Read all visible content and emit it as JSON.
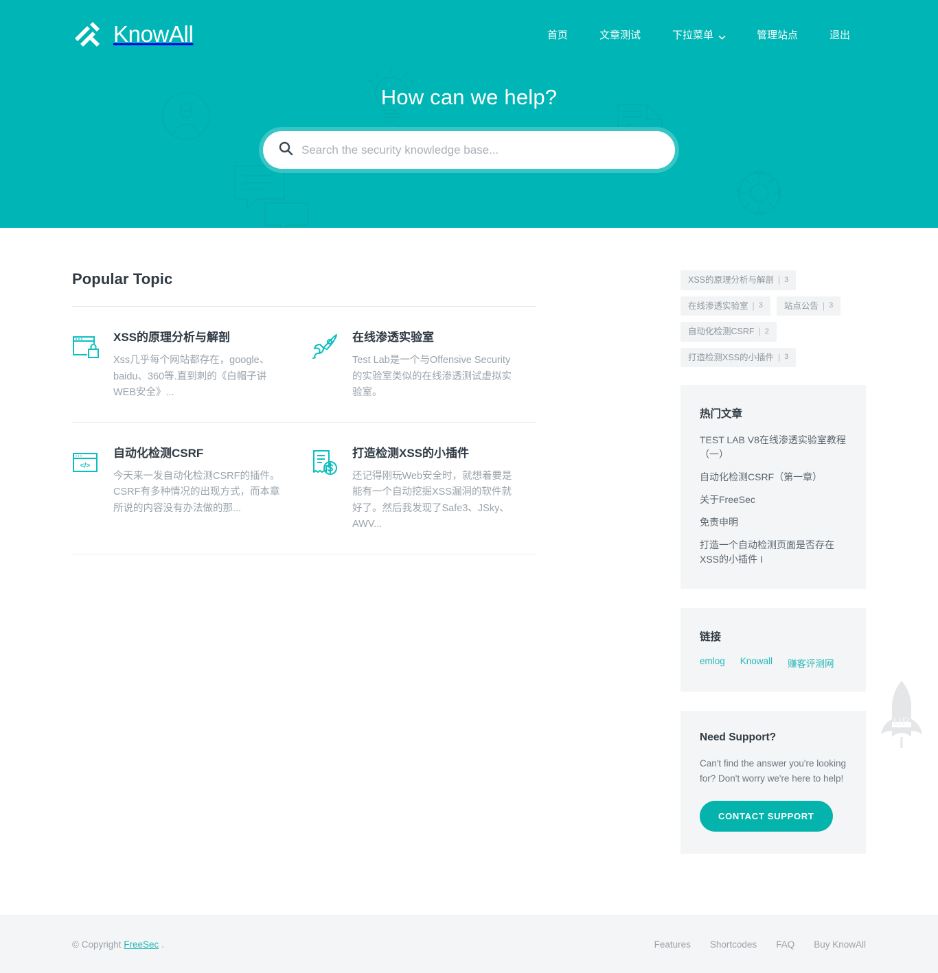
{
  "theme": {
    "brand_teal": "#00b5b5",
    "accent_teal": "#04b3ac",
    "link_teal": "#26b8b8",
    "panel_grey": "#f4f5f6",
    "text_dark": "#2f3a44",
    "text_muted": "#9aa3aa"
  },
  "header": {
    "brand_name": "KnowAll",
    "logo_icon": "knowall-hatch-logo-icon",
    "nav": [
      {
        "label": "首页",
        "icon": null
      },
      {
        "label": "文章测试",
        "icon": null
      },
      {
        "label": "下拉菜单",
        "icon": "chevron-down-icon"
      },
      {
        "label": "管理站点",
        "icon": null
      },
      {
        "label": "退出",
        "icon": null
      }
    ]
  },
  "hero": {
    "title": "How can we help?",
    "search": {
      "icon": "search-icon",
      "value": "",
      "placeholder": "Search the security knowledge base..."
    },
    "decorations": [
      "user-avatar-outline-icon",
      "lightbulb-outline-icon",
      "document-checklist-outline-icon",
      "chat-bubbles-outline-icon",
      "life-ring-outline-icon"
    ]
  },
  "main": {
    "section_title": "Popular Topic",
    "topics": [
      {
        "icon": "browser-lock-icon",
        "title": "XSS的原理分析与解剖",
        "desc": "Xss几乎每个网站都存在，google、baidu、360等.直到刺的《白帽子讲WEB安全》..."
      },
      {
        "icon": "rocket-icon",
        "title": "在线渗透实验室",
        "desc": "Test Lab是一个与Offensive Security的实验室类似的在线渗透测试虚拟实验室。"
      },
      {
        "icon": "code-window-icon",
        "title": "自动化检测CSRF",
        "desc": "今天来一发自动化检测CSRF的插件。CSRF有多种情况的出现方式，而本章所说的内容没有办法做的那..."
      },
      {
        "icon": "invoice-dollar-icon",
        "title": "打造检测XSS的小插件",
        "desc": "还记得刚玩Web安全时，就想着要是能有一个自动挖掘XSS漏洞的软件就好了。然后我发现了Safe3、JSky、AWV..."
      }
    ]
  },
  "sidebar": {
    "tags": [
      {
        "label": "XSS的原理分析与解剖",
        "count": "3"
      },
      {
        "label": "在线渗透实验室",
        "count": "3"
      },
      {
        "label": "站点公告",
        "count": "3"
      },
      {
        "label": "自动化检测CSRF",
        "count": "2"
      },
      {
        "label": "打造检测XSS的小插件",
        "count": "3"
      }
    ],
    "popular": {
      "title": "热门文章",
      "items": [
        "TEST LAB V8在线渗透实验室教程（一）",
        "自动化检测CSRF（第一章）",
        "关于FreeSec",
        "免责申明",
        "打造一个自动检测页面是否存在XSS的小插件 I"
      ]
    },
    "links": {
      "title": "链接",
      "items": [
        "emlog",
        "Knowall",
        "赚客评测网"
      ]
    },
    "support": {
      "title": "Need Support?",
      "text": "Can't find the answer you're looking for? Don't worry we're here to help!",
      "button_label": "CONTACT SUPPORT"
    }
  },
  "back_to_top": {
    "label": "UP",
    "icon": "rocket-up-icon"
  },
  "footer": {
    "copyright_prefix": "© Copyright ",
    "copyright_link": "FreeSec",
    "copyright_suffix": " .",
    "links": [
      "Features",
      "Shortcodes",
      "FAQ",
      "Buy KnowAll"
    ]
  }
}
